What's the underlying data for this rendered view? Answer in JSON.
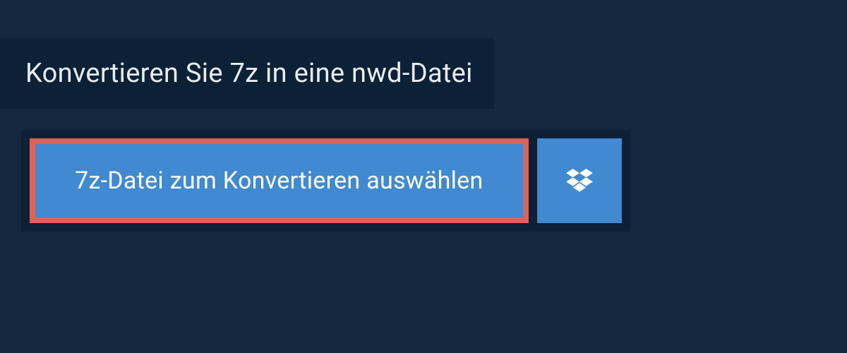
{
  "header": {
    "title": "Konvertieren Sie 7z in eine nwd-Datei"
  },
  "actions": {
    "select_file_label": "7z-Datei zum Konvertieren auswählen"
  },
  "colors": {
    "background": "#15283c",
    "header_bg": "#0c2136",
    "button_bg": "#4189d0",
    "highlight_border": "#d96459",
    "text_light": "#e8eef4",
    "text_white": "#ffffff"
  }
}
